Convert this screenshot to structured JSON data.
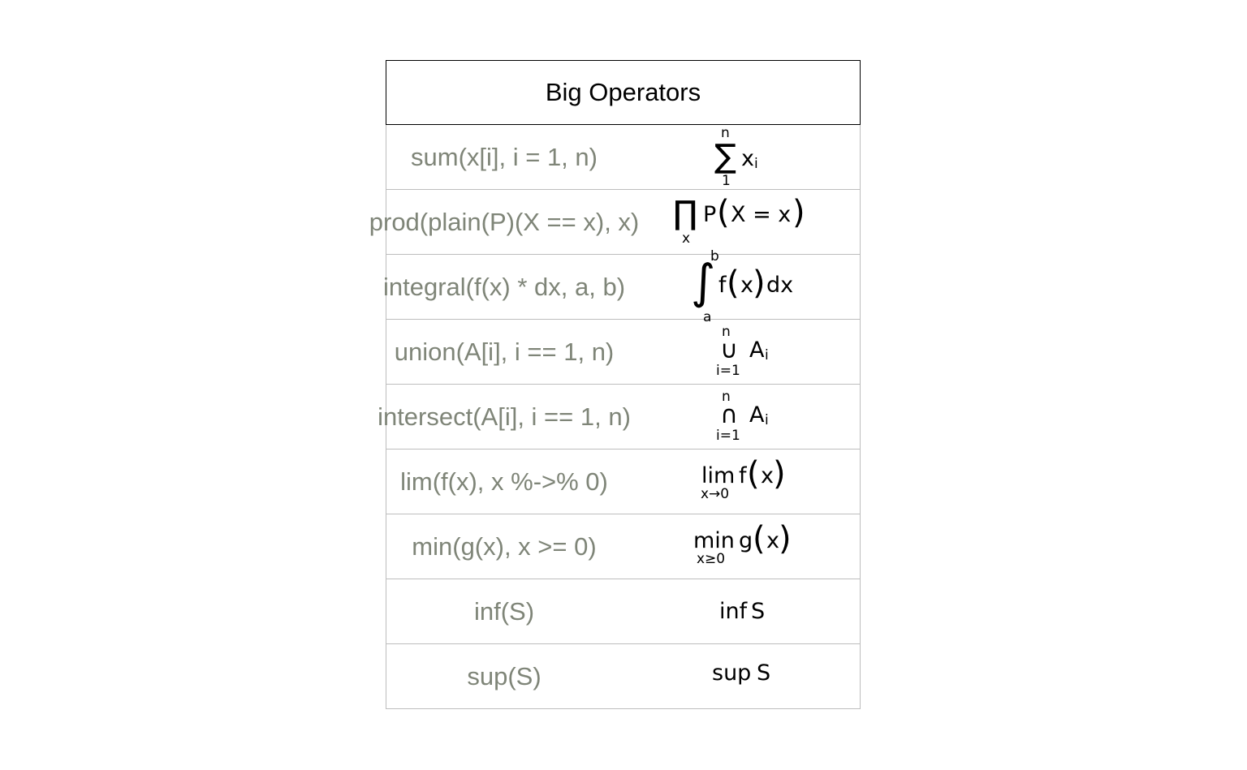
{
  "title": "Big Operators",
  "rows": [
    {
      "expr": "sum(x[i], i = 1, n)",
      "op": "∑",
      "upper": "n",
      "lower": "1",
      "body": "x",
      "body_sub": "i"
    },
    {
      "expr": "prod(plain(P)(X == x), x)",
      "op": "∏",
      "lower": "x",
      "body_start": "P",
      "paren_open": "(",
      "body_inner": "X = x",
      "paren_close": ")"
    },
    {
      "expr": "integral(f(x) * dx, a, b)",
      "op": "∫",
      "upper": "b",
      "lower": "a",
      "body_start": "f",
      "paren_open": "(",
      "body_inner": "x",
      "paren_close": ")",
      "body_end": "dx"
    },
    {
      "expr": "union(A[i], i == 1, n)",
      "op": "∪",
      "upper": "n",
      "lower": "i=1",
      "body": "A",
      "body_sub": "i"
    },
    {
      "expr": "intersect(A[i], i == 1, n)",
      "op": "∩",
      "upper": "n",
      "lower": "i=1",
      "body": "A",
      "body_sub": "i"
    },
    {
      "expr": "lim(f(x), x %->% 0)",
      "op": "lim",
      "lower": "x→0",
      "body_start": "f",
      "paren_open": "(",
      "body_inner": "x",
      "paren_close": ")"
    },
    {
      "expr": "min(g(x), x >= 0)",
      "op": "min",
      "lower": "x≥0",
      "body_start": "g",
      "paren_open": "(",
      "body_inner": "x",
      "paren_close": ")"
    },
    {
      "expr": "inf(S)",
      "op": "inf",
      "body": "S"
    },
    {
      "expr": "sup(S)",
      "op": "sup",
      "body": "S"
    }
  ]
}
